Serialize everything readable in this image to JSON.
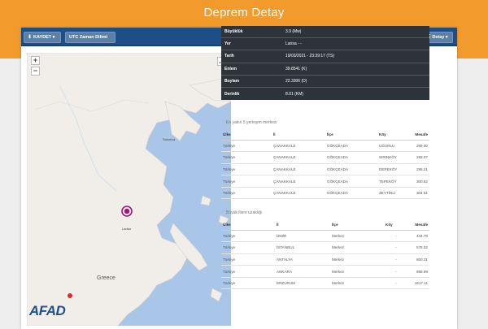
{
  "page": {
    "title": "Deprem Detay"
  },
  "toolbar": {
    "save_label": "KAYDET",
    "utc_label": "UTC Zaman Dilimi",
    "detail_label": "Detay"
  },
  "map": {
    "zoom_in": "+",
    "zoom_out": "−",
    "labels": {
      "salonica": "Salonica",
      "larisa": "Larisa",
      "greece": "Greece"
    },
    "logo_text": "AFAD"
  },
  "info": {
    "rows": [
      {
        "key": "Büyüklük",
        "value": "3.9 (Mw)"
      },
      {
        "key": "Yer",
        "value": "Larisa - -"
      },
      {
        "key": "Tarih",
        "value": "19/03/2021 - 23:39:17 (TS)"
      },
      {
        "key": "Enlem",
        "value": "39.8541 (K)"
      },
      {
        "key": "Boylam",
        "value": "22.3306 (D)"
      },
      {
        "key": "Derinlik",
        "value": "8.01 (KM)"
      }
    ]
  },
  "nearest": {
    "title": "En yakın 5 yerleşim merkezi",
    "headers": [
      "Ülke",
      "İl",
      "İlçe",
      "Köy",
      "Mesafe"
    ],
    "rows": [
      [
        "Türkiye",
        "ÇANAKKALE",
        "GÖKÇEADA",
        "UĞURLU",
        "289.00"
      ],
      [
        "Türkiye",
        "ÇANAKKALE",
        "GÖKÇEADA",
        "SIRINKÖY",
        "293.07"
      ],
      [
        "Türkiye",
        "ÇANAKKALE",
        "GÖKÇEADA",
        "DEREKÖY",
        "295.21"
      ],
      [
        "Türkiye",
        "ÇANAKKALE",
        "GÖKÇEADA",
        "TEPEKÖY",
        "300.52"
      ],
      [
        "Türkiye",
        "ÇANAKKALE",
        "GÖKÇEADA",
        "ZEYTİNLİ",
        "304.51"
      ]
    ]
  },
  "cities": {
    "title": "Büyük illere uzaklığı",
    "headers": [
      "Ülke",
      "İl",
      "İlçe",
      "Köy",
      "Mesafe"
    ],
    "rows": [
      [
        "Türkiye",
        "İZMİR",
        "Merkez",
        "-",
        "444.78"
      ],
      [
        "Türkiye",
        "İSTANBUL",
        "Merkez",
        "-",
        "578.02"
      ],
      [
        "Türkiye",
        "ANTALYA",
        "Merkez",
        "-",
        "800.31"
      ],
      [
        "Türkiye",
        "ANKARA",
        "Merkez",
        "-",
        "898.99"
      ],
      [
        "Türkiye",
        "ERZURUM",
        "Merkez",
        "-",
        "1617.11"
      ]
    ]
  },
  "colors": {
    "orange_band": "#f29a2c",
    "header_blue": "#1e4e87",
    "info_dark": "#2d3338",
    "sea": "#a9c6e8",
    "epicenter": "#a3147a"
  },
  "icons": {
    "save": "download-icon",
    "detail": "list-icon",
    "fullscreen": "expand-icon"
  }
}
